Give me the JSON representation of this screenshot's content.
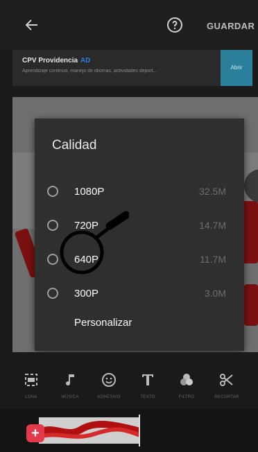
{
  "topbar": {
    "save_label": "GUARDAR"
  },
  "ad": {
    "title": "CPV Providencia",
    "badge": "AD",
    "description": "Aprendizaje continuo, manejo de idiomas, actividades deport...",
    "cta": "Abrir"
  },
  "dialog": {
    "title": "Calidad",
    "options": [
      {
        "label": "1080P",
        "size": "32.5M"
      },
      {
        "label": "720P",
        "size": "14.7M"
      },
      {
        "label": "640P",
        "size": "11.7M"
      },
      {
        "label": "300P",
        "size": "3.0M"
      }
    ],
    "custom_label": "Personalizar"
  },
  "tools": [
    {
      "label": "LONA",
      "icon": "canvas-icon"
    },
    {
      "label": "MÚSICA",
      "icon": "music-icon"
    },
    {
      "label": "ADHESIVO",
      "icon": "sticker-icon"
    },
    {
      "label": "TEXTO",
      "icon": "text-icon"
    },
    {
      "label": "FILTRO",
      "icon": "filter-icon"
    },
    {
      "label": "RECORTAR",
      "icon": "scissors-icon"
    }
  ],
  "colors": {
    "accent": "#e23a4a",
    "ad_badge": "#2f7de1",
    "ad_cta": "#2c7f9a"
  }
}
